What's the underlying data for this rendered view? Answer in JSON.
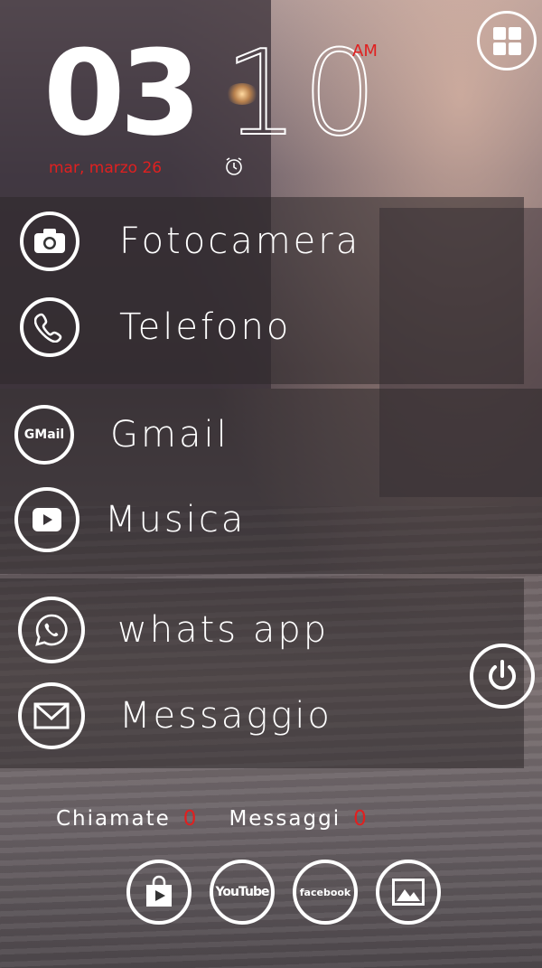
{
  "clock": {
    "hours": "03",
    "minutes": "10",
    "ampm": "AM",
    "date": "mar, marzo 26"
  },
  "apps": [
    {
      "label": "Fotocamera",
      "icon": "camera-icon"
    },
    {
      "label": "Telefono",
      "icon": "phone-icon"
    },
    {
      "label": "Gmail",
      "icon": "gmail-icon",
      "icon_text": "GMail"
    },
    {
      "label": "Musica",
      "icon": "youtube-play-icon"
    },
    {
      "label": "whats app",
      "icon": "whatsapp-icon"
    },
    {
      "label": "Messaggio",
      "icon": "envelope-icon"
    }
  ],
  "counters": {
    "calls_label": "Chiamate",
    "calls_value": "0",
    "messages_label": "Messaggi",
    "messages_value": "0"
  },
  "dock": [
    {
      "icon": "play-store-icon"
    },
    {
      "icon": "youtube-icon",
      "text": "YouTube"
    },
    {
      "icon": "facebook-icon",
      "text": "facebook"
    },
    {
      "icon": "gallery-icon"
    }
  ],
  "colors": {
    "accent_red": "#e02020",
    "foreground": "#ffffff"
  }
}
